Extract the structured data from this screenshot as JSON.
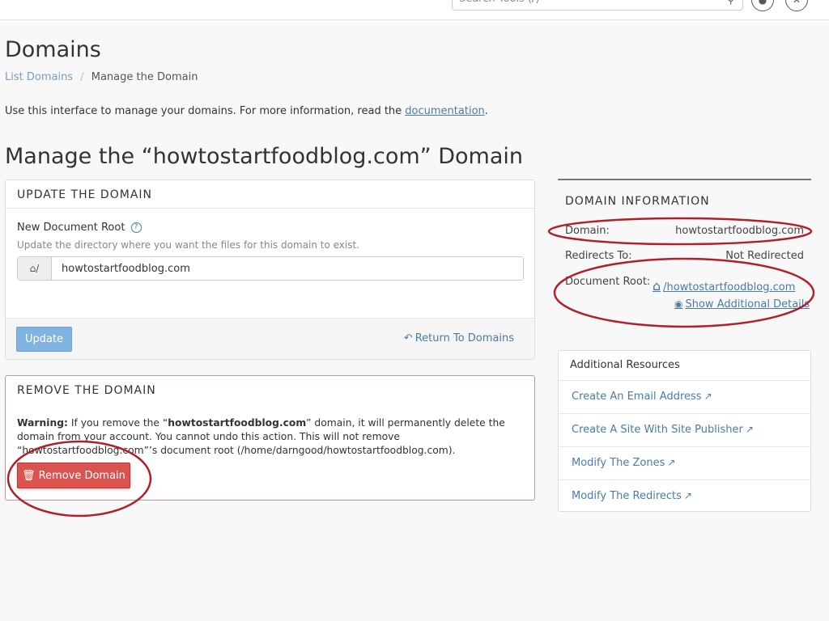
{
  "topbar": {
    "search_placeholder": "Search Tools (/)",
    "search_icon": "search-icon",
    "notifications_icon": "bell-icon",
    "user_icon": "user-icon"
  },
  "page": {
    "title": "Domains",
    "breadcrumb": {
      "link": "List Domains",
      "separator": "/",
      "current": "Manage the Domain"
    },
    "intro_text": "Use this interface to manage your domains. For more information, read the ",
    "intro_link": "documentation",
    "intro_end": ".",
    "manage_title": "Manage the “howtostartfoodblog.com” Domain"
  },
  "update_panel": {
    "heading": "UPDATE THE DOMAIN",
    "field_label": "New Document Root",
    "help_icon": "?",
    "help_text": "Update the directory where you want the files for this domain to exist.",
    "addon_text": "⌂/",
    "input_value": "howtostartfoodblog.com",
    "update_button": "Update",
    "return_link": "Return To Domains"
  },
  "remove_panel": {
    "heading": "REMOVE THE DOMAIN",
    "warning_label": "Warning:",
    "warning_text_1": " If you remove the “",
    "warning_domain": "howtostartfoodblog.com",
    "warning_text_2": "” domain, it will permanently delete the domain from your account. You cannot undo this action. This will not remove “howtostartfoodblog.com”’s document root (/home/darngood/howtostartfoodblog.com).",
    "remove_button": "Remove Domain"
  },
  "domain_info": {
    "title": "DOMAIN INFORMATION",
    "domain_label": "Domain:",
    "domain_value": "howtostartfoodblog.com",
    "redirects_label": "Redirects To:",
    "redirects_value": "Not Redirected",
    "docroot_label": "Document Root:",
    "docroot_value": "/howtostartfoodblog.com",
    "show_details": "Show Additional Details"
  },
  "resources": {
    "heading": "Additional Resources",
    "items": [
      {
        "label": "Create An Email Address"
      },
      {
        "label": "Create A Site With Site Publisher"
      },
      {
        "label": "Modify The Zones"
      },
      {
        "label": "Modify The Redirects"
      }
    ]
  },
  "colors": {
    "link": "#4a7ba6",
    "update_button": "#80b3e0",
    "remove_button": "#d9534f",
    "annotation": "#b0202a"
  }
}
